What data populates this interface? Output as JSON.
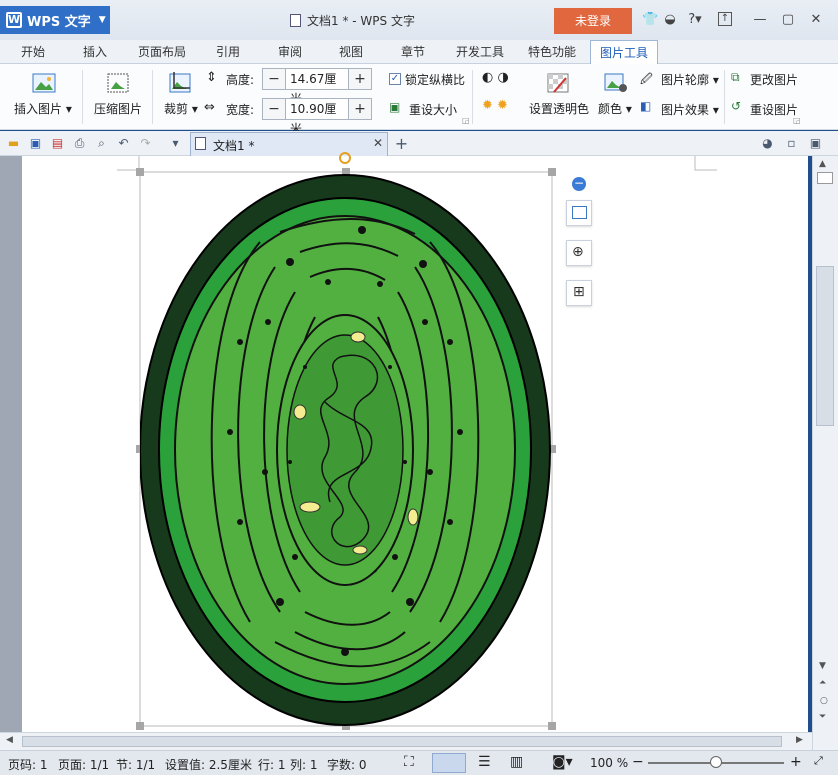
{
  "window": {
    "app_name": "WPS 文字",
    "doc_title": "文档1 * - WPS 文字",
    "login_label": "未登录"
  },
  "tabs": [
    "开始",
    "插入",
    "页面布局",
    "引用",
    "审阅",
    "视图",
    "章节",
    "开发工具",
    "特色功能",
    "图片工具"
  ],
  "active_tab": "图片工具",
  "ribbon": {
    "insert_picture": "插入图片",
    "compress_picture": "压缩图片",
    "crop": "裁剪",
    "height_label": "高度:",
    "height_value": "14.67厘米",
    "width_label": "宽度:",
    "width_value": "10.90厘米",
    "lock_ratio": "锁定纵横比",
    "reset_size": "重设大小",
    "set_transparent": "设置透明色",
    "color": "颜色",
    "picture_outline": "图片轮廓",
    "picture_effect": "图片效果",
    "change_picture": "更改图片",
    "reset_picture": "重设图片"
  },
  "doc_tab": {
    "label": "文档1 *"
  },
  "status": {
    "page_code": "页码: 1",
    "pages": "页面: 1/1",
    "section": "节: 1/1",
    "setting": "设置值: 2.5厘米",
    "row": "行: 1",
    "col": "列: 1",
    "chars": "字数: 0",
    "zoom": "100 %"
  },
  "colors": {
    "accent": "#2f6fc7",
    "login": "#e0673e",
    "cell_outer": "#1a3d20",
    "cell_ring": "#2aa13a",
    "cell_body": "#52b040"
  }
}
